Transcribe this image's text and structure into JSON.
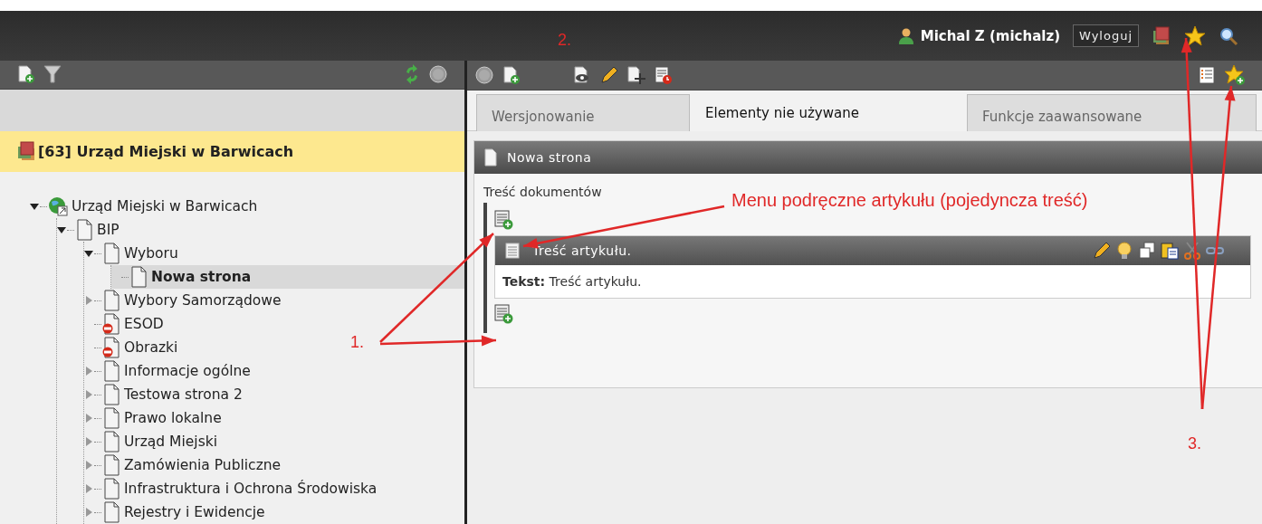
{
  "user": {
    "name": "Michal Z (michalz)",
    "logout": "Wyloguj"
  },
  "site_header": {
    "title": "[63] Urząd Miejski w Barwicach"
  },
  "tree": [
    {
      "label": "Urząd Miejski w Barwicach",
      "kind": "site",
      "expanded": true,
      "selected": false,
      "children": [
        {
          "label": "BIP",
          "kind": "page",
          "expanded": true,
          "selected": false,
          "children": [
            {
              "label": "Wyboru",
              "kind": "page",
              "expanded": true,
              "selected": false,
              "children": [
                {
                  "label": "Nowa strona",
                  "kind": "page",
                  "selected": true
                }
              ]
            },
            {
              "label": "Wybory Samorządowe",
              "kind": "page",
              "expanded": false,
              "selected": false
            },
            {
              "label": "ESOD",
              "kind": "blocked",
              "selected": false
            },
            {
              "label": "Obrazki",
              "kind": "blocked",
              "selected": false
            },
            {
              "label": "Informacje ogólne",
              "kind": "page",
              "expanded": false,
              "selected": false
            },
            {
              "label": "Testowa strona 2",
              "kind": "page",
              "expanded": false,
              "selected": false
            },
            {
              "label": "Prawo lokalne",
              "kind": "page",
              "expanded": false,
              "selected": false
            },
            {
              "label": "Urząd Miejski",
              "kind": "page",
              "expanded": false,
              "selected": false
            },
            {
              "label": "Zamówienia Publiczne",
              "kind": "page",
              "expanded": false,
              "selected": false
            },
            {
              "label": "Infrastruktura i Ochrona Środowiska",
              "kind": "page",
              "expanded": false,
              "selected": false
            },
            {
              "label": "Rejestry i Ewidencje",
              "kind": "page",
              "expanded": false,
              "selected": false
            }
          ]
        }
      ]
    }
  ],
  "tabs": [
    {
      "label": "Wersjonowanie",
      "selected": false
    },
    {
      "label": "Elementy nie używane",
      "selected": true
    },
    {
      "label": "Funkcje zaawansowane",
      "selected": false
    }
  ],
  "page_panel": {
    "title": "Nowa strona",
    "section_label": "Treść dokumentów",
    "articles": [
      {
        "title": "Treść artykułu.",
        "body": "**Tekst:** Treść artykułu."
      }
    ]
  },
  "annotations": [
    {
      "label": "2."
    },
    {
      "label": "Menu podręczne artykułu (pojedyncza treść)"
    },
    {
      "label": "1."
    },
    {
      "label": "3."
    }
  ]
}
